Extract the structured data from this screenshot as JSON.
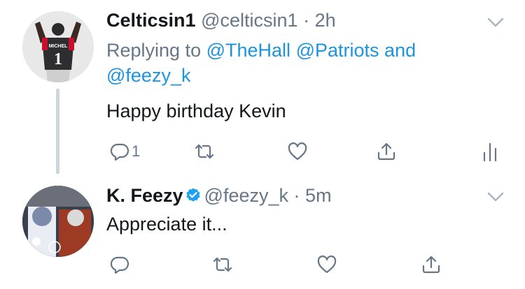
{
  "tweets": [
    {
      "display_name": "Celticsin1",
      "handle": "@celticsin1",
      "separator": "·",
      "time": "2h",
      "replying_prefix": "Replying to",
      "mentions": [
        "@TheHall",
        "@Patriots"
      ],
      "mentions_joiner": "and",
      "last_mention": "@feezy_k",
      "text": "Happy birthday Kevin",
      "reply_count": "1",
      "avatar_icon": "football-player-avatar",
      "jersey_name": "MICHEL",
      "jersey_number": "1"
    },
    {
      "display_name": "K. Feezy",
      "verified": true,
      "handle": "@feezy_k",
      "separator": "·",
      "time": "5m",
      "text": "Appreciate it...",
      "avatar_icon": "football-collage-avatar"
    }
  ],
  "colors": {
    "accent": "#1b95e0",
    "secondary_text": "#657786",
    "primary_text": "#14171a",
    "thread_line": "#ccd6dd",
    "verified_badge": "#1da1f2"
  }
}
